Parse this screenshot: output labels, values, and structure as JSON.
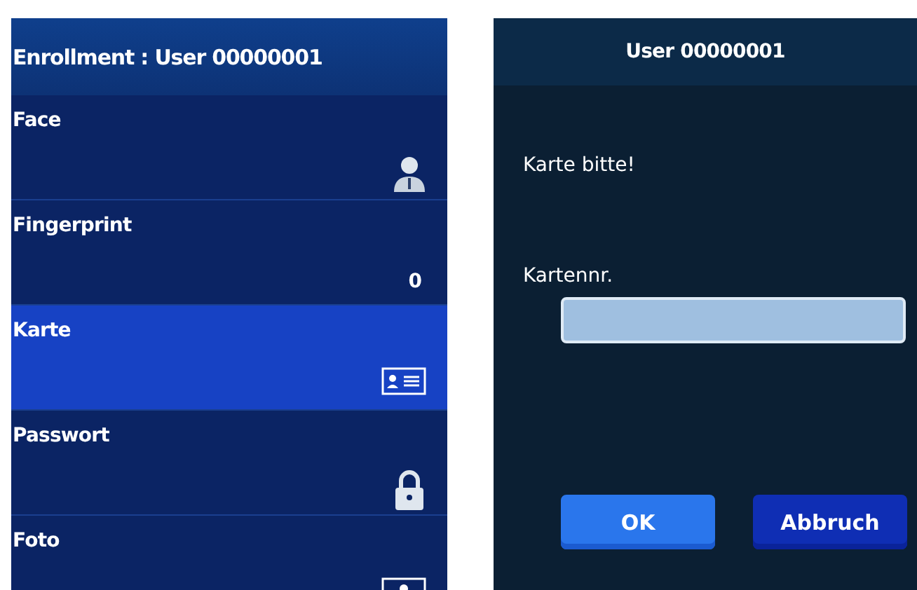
{
  "enrollment_screen": {
    "title": "Enrollment : User 00000001",
    "items": [
      {
        "label": "Face",
        "kind": "face",
        "selected": false
      },
      {
        "label": "Fingerprint",
        "kind": "count",
        "value": "0",
        "selected": false
      },
      {
        "label": "Karte",
        "kind": "card",
        "selected": true
      },
      {
        "label": "Passwort",
        "kind": "password",
        "selected": false
      },
      {
        "label": "Foto",
        "kind": "photo",
        "selected": false
      }
    ]
  },
  "card_dialog": {
    "title": "User 00000001",
    "prompt": "Karte bitte!",
    "field_label": "Kartennr.",
    "buttons": [
      {
        "label": "OK",
        "selected": true
      },
      {
        "label": "Abbruch",
        "selected": false
      }
    ]
  }
}
